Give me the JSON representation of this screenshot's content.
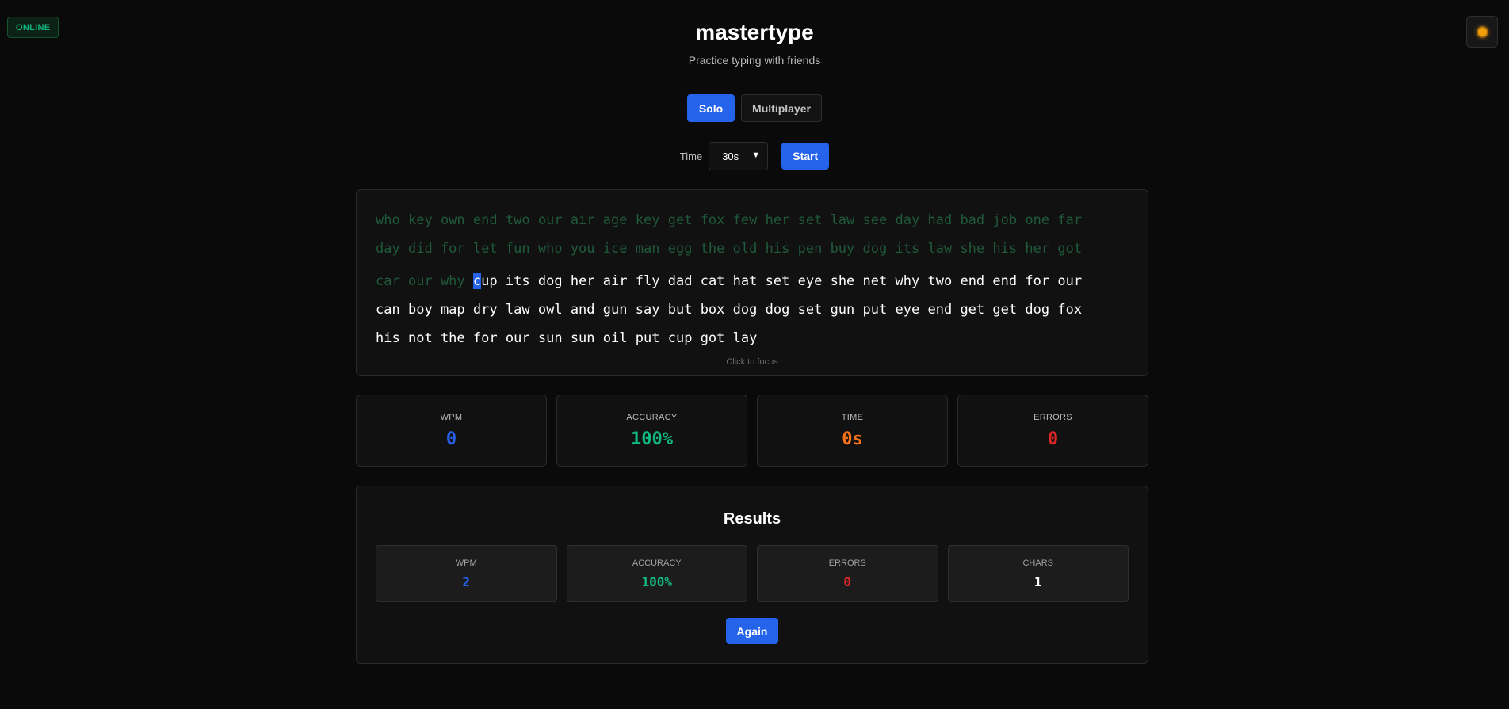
{
  "status": {
    "label": "ONLINE",
    "color": "#10b981"
  },
  "theme_toggle": {
    "icon": "sun-icon"
  },
  "header": {
    "title": "mastertype",
    "subtitle": "Practice typing with friends"
  },
  "modes": {
    "solo": "Solo",
    "multiplayer": "Multiplayer",
    "active": "Solo"
  },
  "controls": {
    "time_label": "Time",
    "time_value": "30s",
    "start_label": "Start"
  },
  "typing": {
    "line1": [
      "who",
      "key",
      "own",
      "end",
      "two",
      "our",
      "air",
      "age",
      "key",
      "get",
      "fox",
      "few",
      "her",
      "set",
      "law",
      "see",
      "day",
      "had",
      "bad",
      "job",
      "one",
      "far"
    ],
    "line2": [
      "day",
      "did",
      "for",
      "let",
      "fun",
      "who",
      "you",
      "ice",
      "man",
      "egg",
      "the",
      "old",
      "his",
      "pen",
      "buy",
      "dog",
      "its",
      "law",
      "she",
      "his",
      "her",
      "got"
    ],
    "line3_typed": [
      "car",
      "our",
      "why"
    ],
    "current_word": "cup",
    "line3_rest": [
      "its",
      "dog",
      "her",
      "air",
      "fly",
      "dad",
      "cat",
      "hat",
      "set",
      "eye",
      "she",
      "net",
      "why",
      "two",
      "end",
      "end",
      "for",
      "our"
    ],
    "line4": [
      "can",
      "boy",
      "map",
      "dry",
      "law",
      "owl",
      "and",
      "gun",
      "say",
      "but",
      "box",
      "dog",
      "dog",
      "set",
      "gun",
      "put",
      "eye",
      "end",
      "get",
      "get",
      "dog",
      "fox"
    ],
    "line5": [
      "his",
      "not",
      "the",
      "for",
      "our",
      "sun",
      "sun",
      "oil",
      "put",
      "cup",
      "got",
      "lay"
    ],
    "hint": "Click to focus",
    "colors": {
      "typed_correct": "#1f5a3b",
      "typed_error": "#7f1d1d",
      "pending": "#ffffff",
      "cursor": "#2563eb"
    }
  },
  "stats": {
    "wpm": {
      "label": "WPM",
      "value": "0",
      "color": "#2563eb"
    },
    "accuracy": {
      "label": "ACCURACY",
      "value": "100%",
      "color": "#10b981"
    },
    "time": {
      "label": "TIME",
      "value": "0s",
      "color": "#f97316"
    },
    "errors": {
      "label": "ERRORS",
      "value": "0",
      "color": "#dc2626"
    }
  },
  "results": {
    "title": "Results",
    "wpm": {
      "label": "WPM",
      "value": "2"
    },
    "accuracy": {
      "label": "ACCURACY",
      "value": "100%"
    },
    "errors": {
      "label": "ERRORS",
      "value": "0"
    },
    "chars": {
      "label": "CHARS",
      "value": "1"
    },
    "again_label": "Again"
  }
}
